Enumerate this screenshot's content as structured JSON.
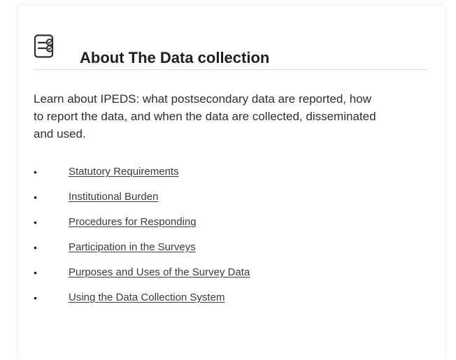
{
  "card": {
    "title": "About The Data collection",
    "icon": "survey-document-icon",
    "intro": "Learn about IPEDS: what postsecondary data are reported, how to report the data, and when the data are collected, disseminated and used."
  },
  "links": [
    {
      "label": "Statutory Requirements"
    },
    {
      "label": "Institutional Burden"
    },
    {
      "label": "Procedures for Responding"
    },
    {
      "label": "Participation in the Surveys"
    },
    {
      "label": "Purposes and Uses of the Survey Data"
    },
    {
      "label": "Using the Data Collection System"
    }
  ],
  "colors": {
    "title": "#1f1f1f",
    "body_text": "#2f2f2f",
    "divider": "#d8d8d8",
    "icon": "#2d2d2d"
  }
}
